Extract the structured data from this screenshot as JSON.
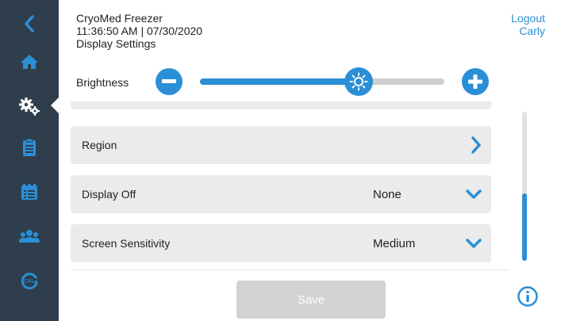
{
  "header": {
    "device_name": "CryoMed Freezer",
    "datetime": "11:36:50 AM | 07/30/2020",
    "page_title": "Display Settings"
  },
  "user": {
    "logout_label": "Logout",
    "username": "Carly"
  },
  "sidebar": {
    "items": [
      {
        "name": "back",
        "icon": "chevron-left-icon"
      },
      {
        "name": "home",
        "icon": "home-icon"
      },
      {
        "name": "settings",
        "icon": "gears-icon",
        "active": true
      },
      {
        "name": "clipboard",
        "icon": "clipboard-icon"
      },
      {
        "name": "log",
        "icon": "log-icon"
      },
      {
        "name": "users",
        "icon": "users-icon"
      },
      {
        "name": "calibration",
        "icon": "calibration-icon"
      }
    ]
  },
  "brightness": {
    "label": "Brightness",
    "level_fraction": 0.65,
    "decrease_icon": "minus-icon",
    "increase_icon": "plus-icon",
    "thumb_icon": "sun-icon"
  },
  "settings_list": [
    {
      "label": "Region",
      "value": "",
      "icon": "chevron-right-icon"
    },
    {
      "label": "Display Off",
      "value": "None",
      "icon": "chevron-down-icon"
    },
    {
      "label": "Screen Sensitivity",
      "value": "Medium",
      "icon": "chevron-down-icon"
    }
  ],
  "scrollbar": {
    "position_fraction": 0.55,
    "visible_fraction": 0.45
  },
  "footer": {
    "save_label": "Save"
  },
  "colors": {
    "accent": "#2a8fd6",
    "sidebar": "#2e3e4c",
    "row_bg": "#ebebeb",
    "disabled_button": "#d2d2d2"
  }
}
